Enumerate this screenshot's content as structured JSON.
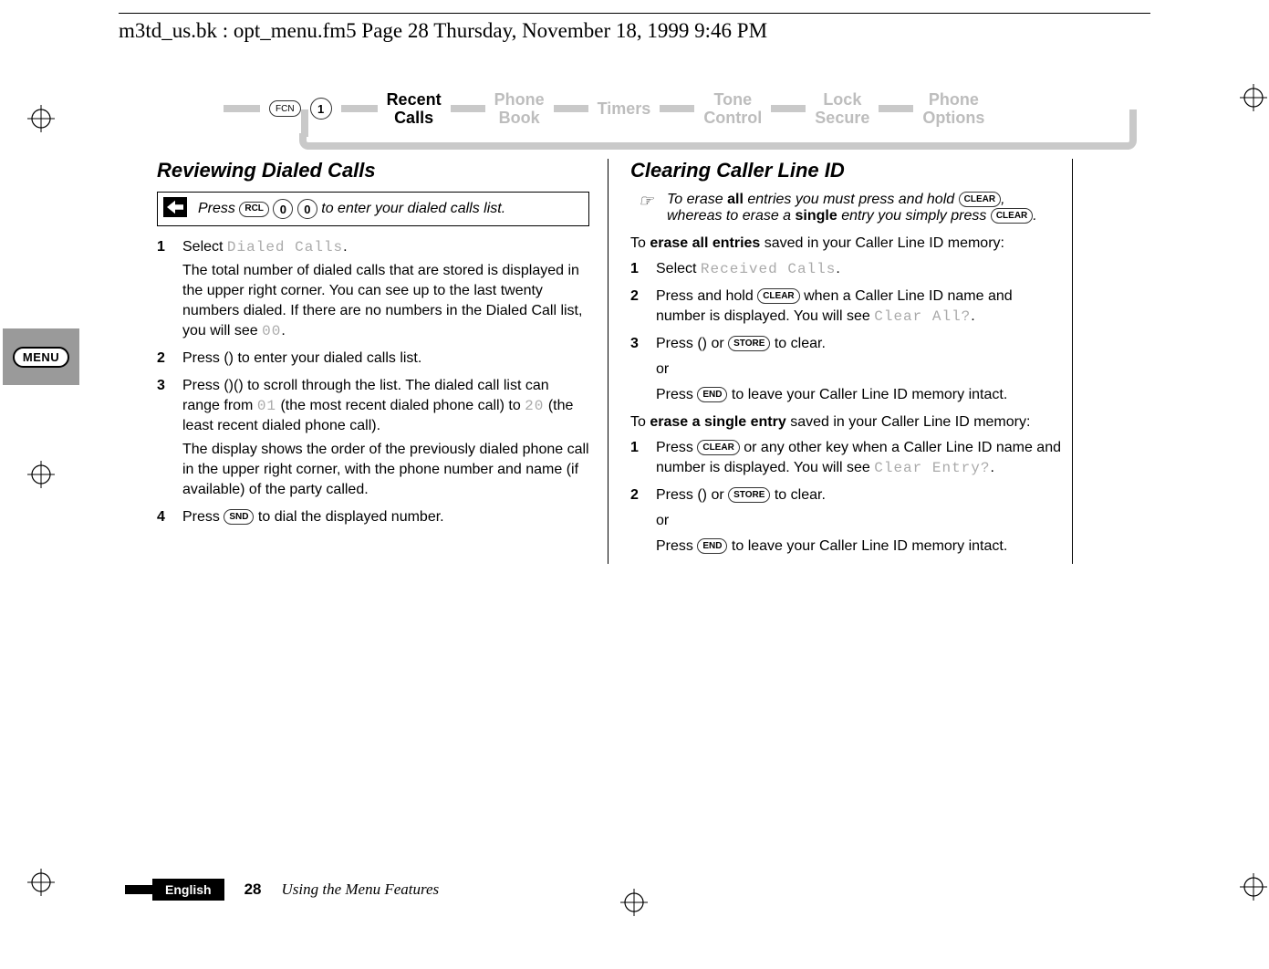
{
  "header_line": "m3td_us.bk : opt_menu.fm5  Page 28  Thursday, November 18, 1999  9:46 PM",
  "nav": {
    "fcn_label": "FCN",
    "one_label": "1",
    "items": [
      {
        "label": "Recent\nCalls",
        "active": true
      },
      {
        "label": "Phone\nBook",
        "active": false
      },
      {
        "label": "Timers",
        "active": false
      },
      {
        "label": "Tone\nControl",
        "active": false
      },
      {
        "label": "Lock\nSecure",
        "active": false
      },
      {
        "label": "Phone\nOptions",
        "active": false
      }
    ]
  },
  "side_badge": "MENU",
  "left": {
    "heading": "Reviewing Dialed Calls",
    "shortcut_prefix": "Press ",
    "shortcut_key_rcl": "RCL",
    "shortcut_key_0a": "0",
    "shortcut_key_0b": "0",
    "shortcut_suffix": " to enter your dialed calls list.",
    "step1_prefix": "Select ",
    "step1_lcd": "Dialed Calls",
    "step1_suffix": ".",
    "step1_body_a": "The total number of dialed calls that are stored is displayed in the upper right corner. You can see up to the last twenty numbers dialed. If there are no numbers in the Dialed Call list, you will see ",
    "step1_lcd2": "00",
    "step1_body_b": ".",
    "step2": "Press () to enter your dialed calls list.",
    "step3_a": "Press ()() to scroll through the list. The dialed call list can range from ",
    "step3_lcd1": "01",
    "step3_b": " (the most recent dialed phone call) to ",
    "step3_lcd2": "20",
    "step3_c": " (the least recent dialed phone call).",
    "step3_body": "The display shows the order of the previously dialed phone call in the upper right corner, with the phone number and name (if available) of the party called.",
    "step4_a": "Press ",
    "step4_key": "SND",
    "step4_b": " to dial the displayed number."
  },
  "right": {
    "heading": "Clearing Caller Line ID",
    "note_a": "To erase ",
    "note_all": "all",
    "note_b": " entries you must press and hold ",
    "note_key1": "CLEAR",
    "note_c": ", whereas to erase a ",
    "note_single": "single",
    "note_d": " entry you simply press ",
    "note_key2": "CLEAR",
    "note_e": ".",
    "intro1_a": "To ",
    "intro1_bold": "erase all entries",
    "intro1_b": " saved in your Caller Line ID memory:",
    "a_step1_prefix": "Select ",
    "a_step1_lcd": "Received Calls",
    "a_step1_suffix": ".",
    "a_step2_a": "Press and hold ",
    "a_step2_key": "CLEAR",
    "a_step2_b": " when a Caller Line ID name and number is displayed. You will see ",
    "a_step2_lcd": "Clear All?",
    "a_step2_c": ".",
    "a_step3_a": "Press () or ",
    "a_step3_key": "STORE",
    "a_step3_b": " to clear.",
    "a_or": "or",
    "a_step3_c": "Press ",
    "a_step3_key2": "END",
    "a_step3_d": " to leave your Caller Line ID memory intact.",
    "intro2_a": "To ",
    "intro2_bold": "erase a single entry",
    "intro2_b": " saved in your Caller Line ID memory:",
    "b_step1_a": "Press ",
    "b_step1_key": "CLEAR",
    "b_step1_b": " or any other key when a Caller Line ID name and number is displayed. You will see ",
    "b_step1_lcd": "Clear Entry?",
    "b_step1_c": ".",
    "b_step2_a": "Press () or ",
    "b_step2_key": "STORE",
    "b_step2_b": " to clear.",
    "b_or": "or",
    "b_step2_c": "Press ",
    "b_step2_key2": "END",
    "b_step2_d": " to leave your Caller Line ID memory intact."
  },
  "footer": {
    "language": "English",
    "page_number": "28",
    "chapter": "Using the Menu Features"
  }
}
